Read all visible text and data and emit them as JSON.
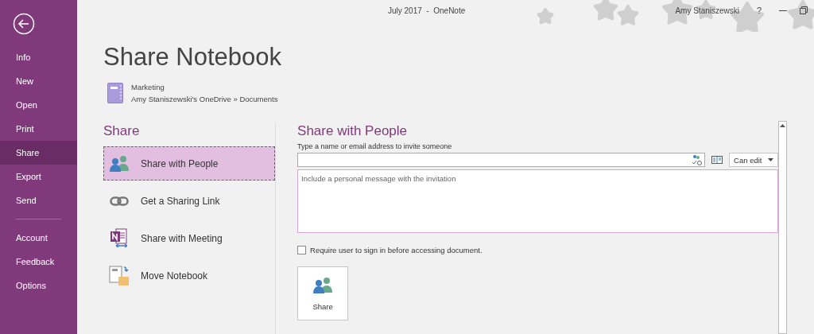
{
  "window": {
    "title": "July 2017  -  OneNote",
    "user": "Amy Staniszewski",
    "help": "?"
  },
  "sidebar": {
    "groups": [
      {
        "items": [
          {
            "label": "Info",
            "selected": false
          },
          {
            "label": "New",
            "selected": false
          },
          {
            "label": "Open",
            "selected": false
          },
          {
            "label": "Print",
            "selected": false
          },
          {
            "label": "Share",
            "selected": true
          },
          {
            "label": "Export",
            "selected": false
          },
          {
            "label": "Send",
            "selected": false
          }
        ]
      },
      {
        "items": [
          {
            "label": "Account",
            "selected": false
          },
          {
            "label": "Feedback",
            "selected": false
          },
          {
            "label": "Options",
            "selected": false
          }
        ]
      }
    ]
  },
  "page": {
    "title": "Share Notebook",
    "notebook": {
      "name": "Marketing",
      "location": "Amy Staniszewski's OneDrive » Documents"
    }
  },
  "share": {
    "heading": "Share",
    "options": [
      {
        "label": "Share with People",
        "kind": "people",
        "selected": true
      },
      {
        "label": "Get a Sharing Link",
        "kind": "link",
        "selected": false
      },
      {
        "label": "Share with Meeting",
        "kind": "meeting",
        "selected": false
      },
      {
        "label": "Move Notebook",
        "kind": "move",
        "selected": false
      }
    ]
  },
  "panel": {
    "heading": "Share with People",
    "invite_label": "Type a name or email address to invite someone",
    "permission": "Can edit",
    "message": {
      "placeholder": "Include a personal message with the invitation"
    },
    "require_sign_in": {
      "label": "Require user to sign in before accessing document.",
      "checked": false
    },
    "share_button": "Share"
  }
}
